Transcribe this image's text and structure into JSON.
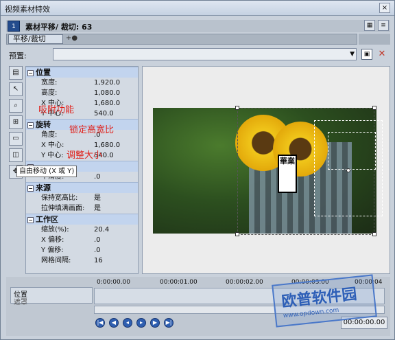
{
  "window": {
    "title": "视频素材特效",
    "close": "×"
  },
  "header": {
    "chip": "1",
    "name": "素材平移/ 裁切:",
    "number": "63"
  },
  "chain": {
    "button": "平移/裁切",
    "plus": "+●"
  },
  "preset": {
    "label": "预置:",
    "value": ""
  },
  "props": {
    "sections": [
      {
        "title": "位置",
        "rows": [
          [
            "宽度:",
            "1,920.0"
          ],
          [
            "高度:",
            "1,080.0"
          ],
          [
            "X 中心:",
            "1,680.0"
          ],
          [
            "Y 中心:",
            "540.0"
          ]
        ]
      },
      {
        "title": "旋转",
        "rows": [
          [
            "角度:",
            ".0"
          ],
          [
            "X 中心:",
            "1,680.0"
          ],
          [
            "Y 中心:",
            "540.0"
          ]
        ]
      },
      {
        "title": "",
        "rows": [
          [
            "平滑度:",
            ".0"
          ]
        ]
      },
      {
        "title": "来源",
        "rows": [
          [
            "保持宽高比:",
            "是"
          ],
          [
            "拉伸填满画面:",
            "是"
          ]
        ]
      },
      {
        "title": "工作区",
        "rows": [
          [
            "缩放(%):",
            "20.4"
          ],
          [
            "X 偏移:",
            ".0"
          ],
          [
            "Y 偏移:",
            ".0"
          ],
          [
            "网格间隔:",
            "16"
          ]
        ]
      }
    ]
  },
  "annotations": {
    "a1": "吸附功能",
    "a2": "锁定高宽比",
    "a3": "调整大小"
  },
  "tooltip": "自由移动 (X 或 Y)",
  "stamp": "華業",
  "timeline": {
    "track_label": "位置",
    "mask_label": "遮罩",
    "ticks": [
      "0:00:00.00",
      "00:00:01.00",
      "00:00:02.00",
      "00:00:03.00",
      "00:00:04"
    ],
    "time": "00:00:00.00"
  },
  "watermark": {
    "text": "欧普软件园",
    "url": "www.opdown.com"
  }
}
